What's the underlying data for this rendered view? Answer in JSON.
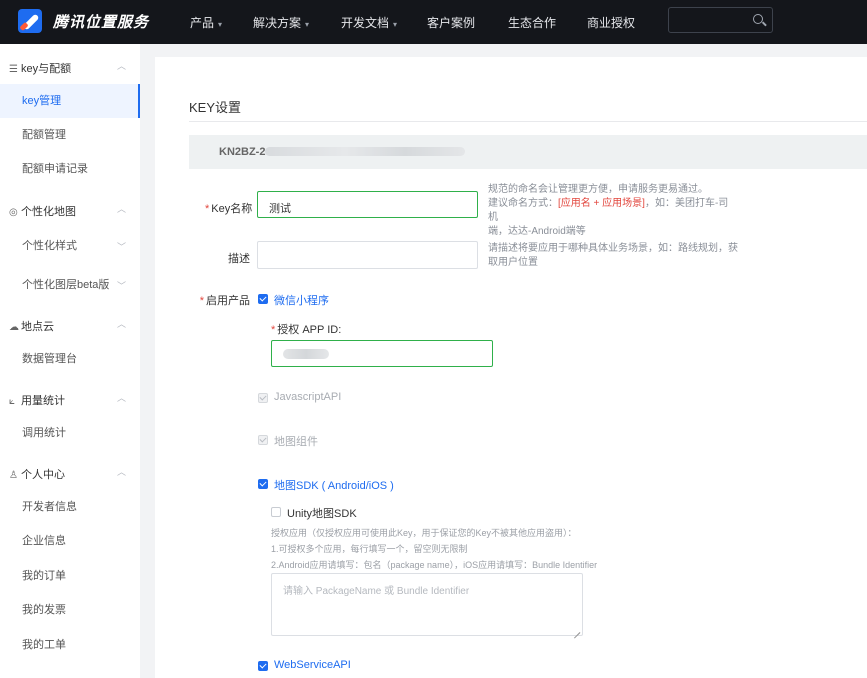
{
  "brand": {
    "name": "腾讯位置服务"
  },
  "nav": {
    "items": [
      {
        "label": "产品",
        "caret": "▾"
      },
      {
        "label": "解决方案",
        "caret": "▾"
      },
      {
        "label": "开发文档",
        "caret": "▾"
      },
      {
        "label": "客户案例",
        "caret": ""
      },
      {
        "label": "生态合作",
        "caret": ""
      },
      {
        "label": "商业授权",
        "caret": ""
      }
    ],
    "search": {
      "value": "",
      "placeholder": ""
    }
  },
  "sidebar": {
    "groups": [
      {
        "icon": "☰",
        "label": "key与配额",
        "arrow": "︿",
        "items": [
          {
            "label": "key管理",
            "active": true
          },
          {
            "label": "配额管理"
          },
          {
            "label": "配额申请记录"
          }
        ]
      },
      {
        "icon": "◎",
        "label": "个性化地图",
        "arrow": "︿",
        "items": [
          {
            "label": "个性化样式",
            "arrow": "﹀"
          },
          {
            "label": "个性化图层beta版",
            "arrow": "﹀"
          }
        ]
      },
      {
        "icon": "☁",
        "label": "地点云",
        "arrow": "︿",
        "items": [
          {
            "label": "数据管理台"
          }
        ]
      },
      {
        "icon": "⟀",
        "label": "用量统计",
        "arrow": "︿",
        "items": [
          {
            "label": "调用统计"
          }
        ]
      },
      {
        "icon": "♙",
        "label": "个人中心",
        "arrow": "︿",
        "items": [
          {
            "label": "开发者信息"
          },
          {
            "label": "企业信息"
          },
          {
            "label": "我的订单"
          },
          {
            "label": "我的发票"
          },
          {
            "label": "我的工单"
          }
        ]
      }
    ]
  },
  "main": {
    "title": "KEY设置",
    "key_prefix": "KN2BZ-2",
    "key_name": {
      "label": "Key名称",
      "value": "测试",
      "hint_line1": "规范的命名会让管理更方便，申请服务更易通过。",
      "hint_line2_prefix": "建议命名方式：",
      "hint_line2_red": "[应用名 + 应用场景]",
      "hint_line2_suffix": "，如：美团打车-司机",
      "hint_line3": "端，达达-Android端等"
    },
    "description": {
      "label": "描述",
      "value": "",
      "hint_line1": "请描述将要应用于哪种具体业务场景，如：路线规划，获",
      "hint_line2": "取用户位置"
    },
    "products": {
      "label": "启用产品",
      "wechat": {
        "label": "微信小程序",
        "checked": true
      },
      "appid_label": "授权 APP ID:",
      "javascript": {
        "label": "JavascriptAPI",
        "checked": true,
        "disabled": true
      },
      "map_component": {
        "label": "地图组件",
        "checked": true,
        "disabled": true
      },
      "sdk": {
        "label": "地图SDK ( Android/iOS )",
        "checked": true
      },
      "unity": {
        "label": "Unity地图SDK",
        "checked": false
      },
      "sdk_note1": "授权应用（仅授权应用可使用此Key，用于保证您的Key不被其他应用盗用）：",
      "sdk_note2": "1.可授权多个应用，每行填写一个，留空则无限制",
      "sdk_note3": "2.Android应用请填写：包名（package name），iOS应用请填写：Bundle Identifier",
      "package_placeholder": "请输入 PackageName 或 Bundle Identifier",
      "webservice": {
        "label": "WebServiceAPI",
        "checked": true
      }
    }
  }
}
